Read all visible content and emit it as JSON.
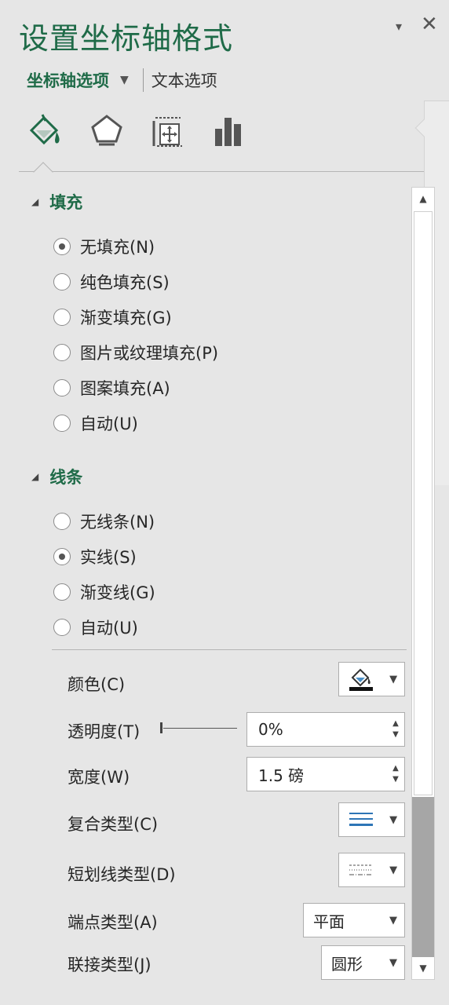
{
  "pane": {
    "title": "设置坐标轴格式",
    "dropdown_glyph": "▾",
    "close_glyph": "✕"
  },
  "tabs": {
    "active": "坐标轴选项",
    "other": "文本选项"
  },
  "category_icons": [
    "fill-line-icon",
    "effects-pentagon-icon",
    "size-properties-icon",
    "axis-options-bar-icon"
  ],
  "fill": {
    "header": "填充",
    "options": [
      {
        "label": "无填充(N)",
        "selected": true
      },
      {
        "label": "纯色填充(S)",
        "selected": false
      },
      {
        "label": "渐变填充(G)",
        "selected": false
      },
      {
        "label": "图片或纹理填充(P)",
        "selected": false
      },
      {
        "label": "图案填充(A)",
        "selected": false
      },
      {
        "label": "自动(U)",
        "selected": false
      }
    ]
  },
  "line": {
    "header": "线条",
    "options": [
      {
        "label": "无线条(N)",
        "selected": false
      },
      {
        "label": "实线(S)",
        "selected": true
      },
      {
        "label": "渐变线(G)",
        "selected": false
      },
      {
        "label": "自动(U)",
        "selected": false
      }
    ]
  },
  "properties": {
    "color_label": "颜色(C)",
    "transparency_label": "透明度(T)",
    "transparency_value": "0%",
    "width_label": "宽度(W)",
    "width_value": "1.5 磅",
    "compound_label": "复合类型(C)",
    "dash_label": "短划线类型(D)",
    "cap_label": "端点类型(A)",
    "cap_value": "平面",
    "join_label": "联接类型(J)",
    "join_value": "圆形"
  },
  "colors": {
    "accent": "#1f6b48",
    "background": "#e6e6e6",
    "scroll_track": "#a6a6a6"
  }
}
